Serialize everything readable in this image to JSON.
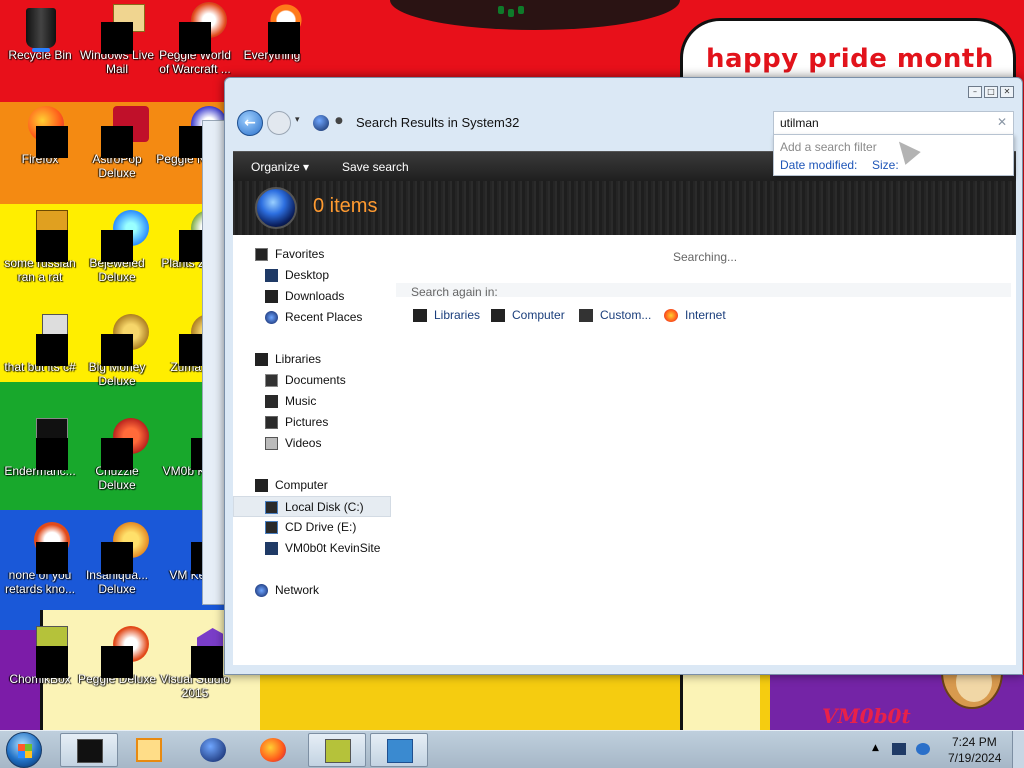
{
  "wallpaper": {
    "banner_text": "happy pride month",
    "logo_text": "VM0b0t"
  },
  "desktop_icons": [
    {
      "label": "Recycle Bin",
      "icon": "recycle-bin-icon"
    },
    {
      "label": "Windows Live Mail",
      "icon": "mail-icon"
    },
    {
      "label": "Peggle World of Warcraft ...",
      "icon": "game-icon"
    },
    {
      "label": "Everything",
      "icon": "search-icon"
    },
    {
      "label": "Firefox",
      "icon": "firefox-icon"
    },
    {
      "label": "AstroPop Deluxe",
      "icon": "game-icon"
    },
    {
      "label": "Peggle N Delu",
      "icon": "game-icon"
    },
    {
      "label": "some russian ran a rat",
      "icon": "file-icon"
    },
    {
      "label": "Bejeweled Deluxe",
      "icon": "game-icon"
    },
    {
      "label": "Plants Zomb",
      "icon": "game-icon"
    },
    {
      "label": "that but its c#",
      "icon": "shortcut-icon"
    },
    {
      "label": "Big Money Deluxe",
      "icon": "game-icon"
    },
    {
      "label": "Zuma De",
      "icon": "game-icon"
    },
    {
      "label": "Endermanc...",
      "icon": "app-icon"
    },
    {
      "label": "Chuzzle Deluxe",
      "icon": "game-icon"
    },
    {
      "label": "VM0b Kevin",
      "icon": "app-icon"
    },
    {
      "label": "none of you retards kno...",
      "icon": "shortcut-icon"
    },
    {
      "label": "Insaniqua... Deluxe",
      "icon": "game-icon"
    },
    {
      "label": "VM Kevin",
      "icon": "app-icon"
    },
    {
      "label": "ChomikBox",
      "icon": "chomikbox-icon"
    },
    {
      "label": "Peggle Deluxe",
      "icon": "game-icon"
    },
    {
      "label": "Visual Studio 2015",
      "icon": "visual-studio-icon"
    }
  ],
  "explorer": {
    "address": "Search Results in System32",
    "search_query": "utilman",
    "filter_title": "Add a search filter",
    "filter_date": "Date modified:",
    "filter_size": "Size:",
    "commands": {
      "organize": "Organize ▾",
      "save_search": "Save search"
    },
    "item_count": "0 items",
    "status": "Searching...",
    "search_again_label": "Search again in:",
    "search_again": [
      {
        "label": "Libraries",
        "icon": "libraries-icon"
      },
      {
        "label": "Computer",
        "icon": "computer-icon"
      },
      {
        "label": "Custom...",
        "icon": "folder-icon"
      },
      {
        "label": "Internet",
        "icon": "firefox-icon"
      }
    ],
    "nav": {
      "favorites": "Favorites",
      "desktop": "Desktop",
      "downloads": "Downloads",
      "recent_places": "Recent Places",
      "libraries": "Libraries",
      "documents": "Documents",
      "music": "Music",
      "pictures": "Pictures",
      "videos": "Videos",
      "computer": "Computer",
      "local_disk": "Local Disk (C:)",
      "cd_drive": "CD Drive (E:)",
      "vm_share": "VM0b0t KevinSite",
      "network": "Network"
    }
  },
  "taskbar": {
    "time": "7:24 PM",
    "date": "7/19/2024",
    "pinned": [
      "explorer-icon",
      "media-player-icon",
      "globe-icon",
      "firefox-icon",
      "chomikbox-icon",
      "network-app-icon"
    ]
  },
  "colors": {
    "accent": "#ff9a30",
    "link": "#1f56b8",
    "banner": "#e2131b"
  }
}
